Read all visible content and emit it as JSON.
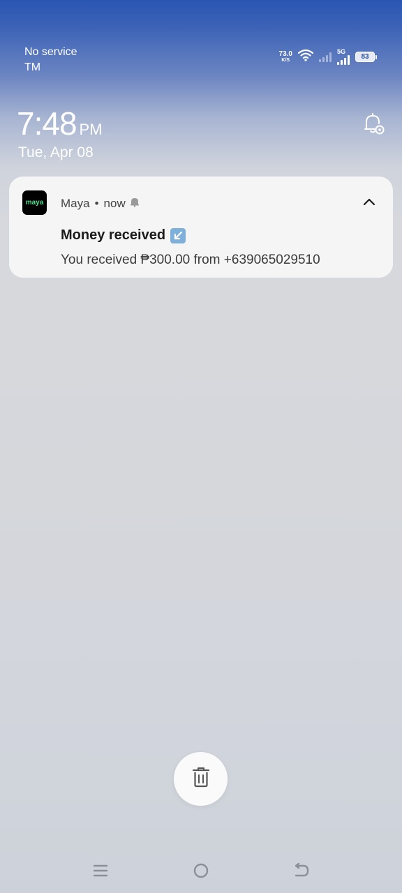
{
  "status_bar": {
    "carrier_line1": "No service",
    "carrier_line2": "TM",
    "net_speed_value": "73.0",
    "net_speed_unit": "K/S",
    "network_type": "5G",
    "battery_level": "83",
    "icons": [
      "wifi-icon",
      "signal-weak-icon",
      "signal-5g-icon",
      "battery-icon"
    ]
  },
  "lock": {
    "time": "7:48",
    "ampm": "PM",
    "date": "Tue, Apr 08"
  },
  "notification": {
    "app_icon_text": "maya",
    "app_name": "Maya",
    "separator": "•",
    "time": "now",
    "title": "Money received",
    "body": "You received ₱300.00 from +639065029510",
    "accent_color": "#48e08a"
  },
  "controls": {
    "clear_all_icon": "trash-icon",
    "nav_icons": [
      "menu-icon",
      "home-icon",
      "back-icon"
    ]
  }
}
